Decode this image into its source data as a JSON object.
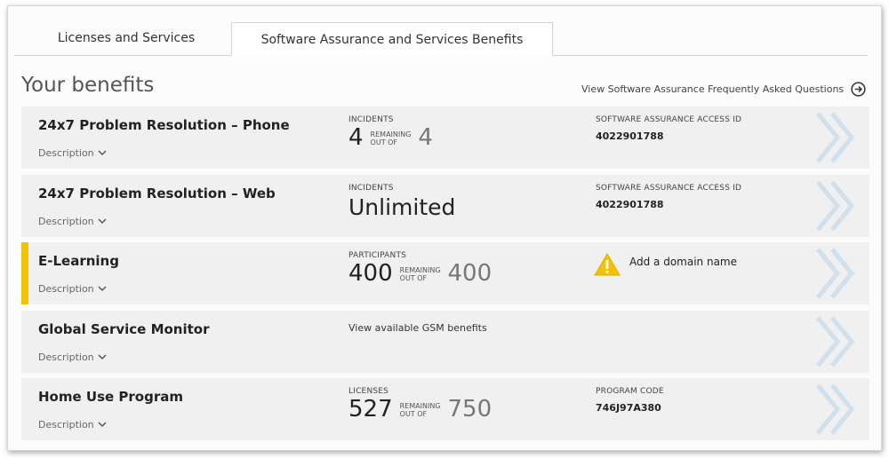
{
  "tabs": [
    {
      "label": "Licenses and Services"
    },
    {
      "label": "Software Assurance and Services Benefits"
    }
  ],
  "page": {
    "heading": "Your benefits",
    "faq_link": "View Software Assurance Frequently Asked Questions"
  },
  "rows": [
    {
      "title": "24x7 Problem Resolution – Phone",
      "description": "Description",
      "metric_label": "INCIDENTS",
      "remaining": "4",
      "remaining_label_1": "REMAINING",
      "remaining_label_2": "OUT OF",
      "total": "4",
      "info_label": "SOFTWARE ASSURANCE ACCESS ID",
      "info_value": "4022901788"
    },
    {
      "title": "24x7 Problem Resolution – Web",
      "description": "Description",
      "metric_label": "INCIDENTS",
      "value": "Unlimited",
      "info_label": "SOFTWARE ASSURANCE ACCESS ID",
      "info_value": "4022901788"
    },
    {
      "title": "E-Learning",
      "description": "Description",
      "metric_label": "PARTICIPANTS",
      "remaining": "400",
      "remaining_label_1": "REMAINING",
      "remaining_label_2": "OUT OF",
      "total": "400",
      "warning_text": "Add a domain name"
    },
    {
      "title": "Global Service Monitor",
      "description": "Description",
      "link_text": "View available GSM benefits"
    },
    {
      "title": "Home Use Program",
      "description": "Description",
      "metric_label": "LICENSES",
      "remaining": "527",
      "remaining_label_1": "REMAINING",
      "remaining_label_2": "OUT OF",
      "total": "750",
      "info_label": "PROGRAM CODE",
      "info_value": "746J97A380"
    }
  ],
  "colors": {
    "accent": "#f2c100",
    "row_bg": "#f0f0f0",
    "chevron": "#cfe0ee"
  },
  "icons": {
    "faq": "arrow-right-circle-icon",
    "description": "chevron-down-icon",
    "row_action": "double-chevron-right-icon",
    "warning": "warning-triangle-icon"
  }
}
